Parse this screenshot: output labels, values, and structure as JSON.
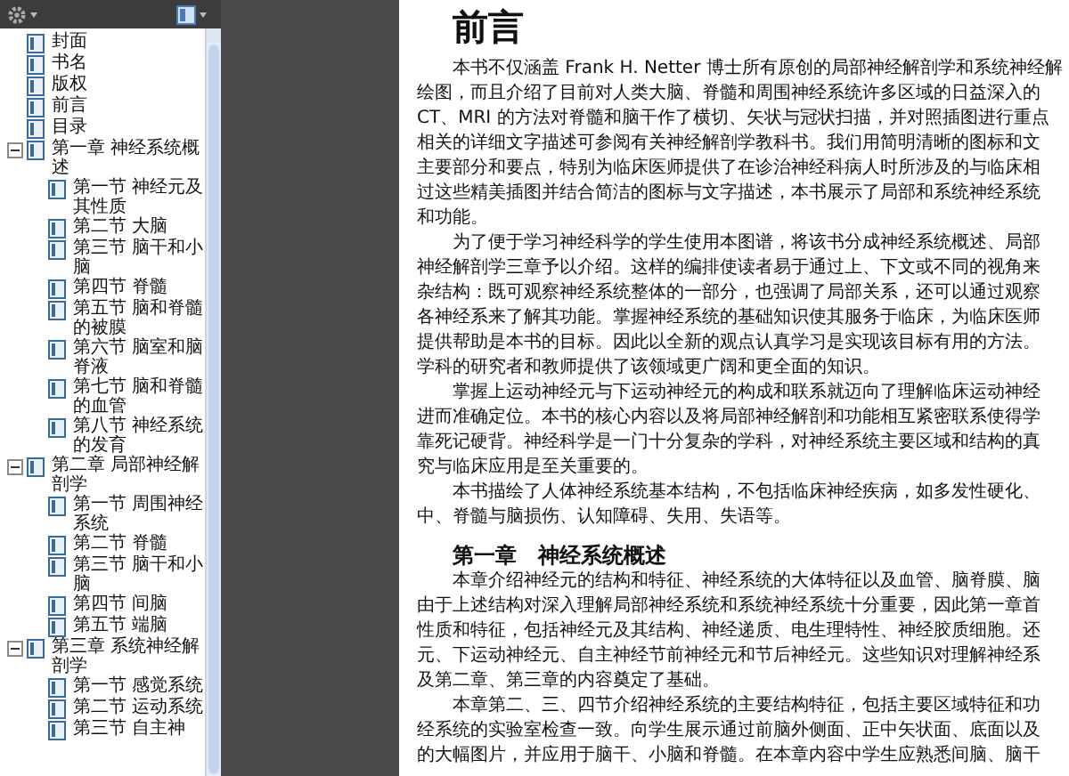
{
  "bookmarks": [
    {
      "label": "封面"
    },
    {
      "label": "书名"
    },
    {
      "label": "版权"
    },
    {
      "label": "前言"
    },
    {
      "label": "目录"
    },
    {
      "label": "第一章 神经系统概述",
      "expanded": true,
      "children": [
        {
          "label": "第一节 神经元及其性质"
        },
        {
          "label": "第二节 大脑"
        },
        {
          "label": "第三节 脑干和小脑"
        },
        {
          "label": "第四节 脊髓"
        },
        {
          "label": "第五节 脑和脊髓的被膜"
        },
        {
          "label": "第六节 脑室和脑脊液"
        },
        {
          "label": "第七节 脑和脊髓的血管"
        },
        {
          "label": "第八节 神经系统的发育"
        }
      ]
    },
    {
      "label": "第二章 局部神经解剖学",
      "expanded": true,
      "children": [
        {
          "label": "第一节 周围神经系统"
        },
        {
          "label": "第二节 脊髓"
        },
        {
          "label": "第三节 脑干和小脑"
        },
        {
          "label": "第四节 间脑"
        },
        {
          "label": "第五节 端脑"
        }
      ]
    },
    {
      "label": "第三章 系统神经解剖学",
      "expanded": true,
      "children": [
        {
          "label": "第一节 感觉系统"
        },
        {
          "label": "第二节 运动系统"
        },
        {
          "label": "第三节 自主神"
        }
      ]
    }
  ],
  "page": {
    "title": "前言",
    "blocks": [
      {
        "kind": "paragraph",
        "lines": [
          "本书不仅涵盖 Frank H. Netter 博士所有原创的局部神经解剖学和系统神经解",
          "绘图，而且介绍了目前对人类大脑、脊髓和周围神经系统许多区域的日益深入的",
          "CT、MRI 的方法对脊髓和脑干作了横切、矢状与冠状扫描，并对照插图进行重点",
          "相关的详细文字描述可参阅有关神经解剖学教科书。我们用简明清晰的图标和文",
          "主要部分和要点，特别为临床医师提供了在诊治神经科病人时所涉及的与临床相",
          "过这些精美插图并结合简洁的图标与文字描述，本书展示了局部和系统神经系统",
          "和功能。"
        ]
      },
      {
        "kind": "paragraph",
        "lines": [
          "为了便于学习神经科学的学生使用本图谱，将该书分成神经系统概述、局部",
          "神经解剖学三章予以介绍。这样的编排使读者易于通过上、下文或不同的视角来",
          "杂结构：既可观察神经系统整体的一部分，也强调了局部关系，还可以通过观察",
          "各神经系来了解其功能。掌握神经系统的基础知识使其服务于临床，为临床医师",
          "提供帮助是本书的目标。因此以全新的观点认真学习是实现该目标有用的方法。",
          "学科的研究者和教师提供了该领域更广阔和更全面的知识。"
        ]
      },
      {
        "kind": "paragraph",
        "lines": [
          "掌握上运动神经元与下运动神经元的构成和联系就迈向了理解临床运动神经",
          "进而准确定位。本书的核心内容以及将局部神经解剖和功能相互紧密联系使得学",
          "靠死记硬背。神经科学是一门十分复杂的学科，对神经系统主要区域和结构的真",
          "究与临床应用是至关重要的。"
        ]
      },
      {
        "kind": "paragraph",
        "lines": [
          "本书描绘了人体神经系统基本结构，不包括临床神经疾病，如多发性硬化、",
          "中、脊髓与脑损伤、认知障碍、失用、失语等。"
        ]
      },
      {
        "kind": "heading",
        "text": "第一章　神经系统概述"
      },
      {
        "kind": "paragraph",
        "lines": [
          "本章介绍神经元的结构和特征、神经系统的大体特征以及血管、脑脊膜、脑",
          "由于上述结构对深入理解局部神经系统和系统神经系统十分重要，因此第一章首",
          "性质和特征，包括神经元及其结构、神经递质、电生理特性、神经胶质细胞。还",
          "元、下运动神经元、自主神经节前神经元和节后神经元。这些知识对理解神经系",
          "及第二章、第三章的内容奠定了基础。"
        ]
      },
      {
        "kind": "paragraph",
        "lines": [
          "本章第二、三、四节介绍神经系统的主要结构特征，包括主要区域特征和功",
          "经系统的实验室检查一致。向学生展示通过前脑外侧面、正中矢状面、底面以及",
          "的大幅图片，并应用于脑干、小脑和脊髓。在本章内容中学生应熟悉间脑、脑干"
        ]
      }
    ]
  }
}
